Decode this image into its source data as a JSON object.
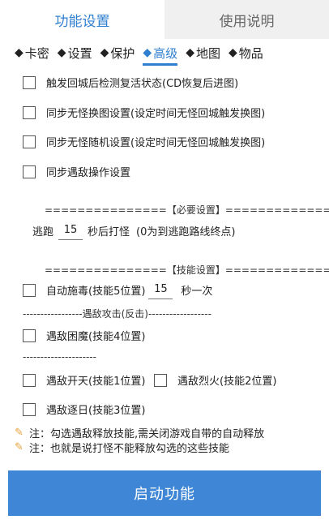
{
  "tabs": [
    {
      "label": "功能设置",
      "active": true
    },
    {
      "label": "使用说明",
      "active": false
    }
  ],
  "subtabs": [
    {
      "label": "卡密"
    },
    {
      "label": "设置"
    },
    {
      "label": "保护"
    },
    {
      "label": "高级"
    },
    {
      "label": "地图"
    },
    {
      "label": "物品"
    }
  ],
  "subtab_diamond": "◆",
  "options": {
    "detect_revive": "触发回城后检测复活状态(CD恢复后进图)",
    "sync_no_monster_map": "同步无怪换图设置(设定时间无怪回城触发换图)",
    "sync_no_monster_random": "同步无怪随机设置(设定时间无怪回城触发换图)",
    "sync_enemy_op": "同步遇敌操作设置"
  },
  "required_settings": {
    "header": "===============【必要设置】=============",
    "flee_prefix": "逃跑",
    "flee_seconds": "15",
    "flee_suffix": "秒后打怪",
    "flee_hint": "(0为到逃跑路线终点)"
  },
  "skill_settings": {
    "header": "===============【技能设置】=============",
    "auto_poison": "自动施毒(技能5位置)",
    "poison_seconds": "15",
    "poison_suffix": "秒一次",
    "enemy_attack_sep": "-----------------遇敌攻击(反击)------------------",
    "enemy_trap": "遇敌困魔(技能4位置)",
    "dash_sep": "---------------------",
    "enemy_open_sky": "遇敌开天(技能1位置)",
    "enemy_blaze": "遇敌烈火(技能2位置)",
    "enemy_chase_sun": "遇敌逐日(技能3位置)"
  },
  "notes": [
    "注：勾选遇敌释放技能,需关闭游戏自带的自动释放",
    "注：也就是说打怪不能释放勾选的这些技能"
  ],
  "start_button": "启动功能",
  "colors": {
    "accent": "#2f7fd0",
    "button": "#3f87d6"
  }
}
